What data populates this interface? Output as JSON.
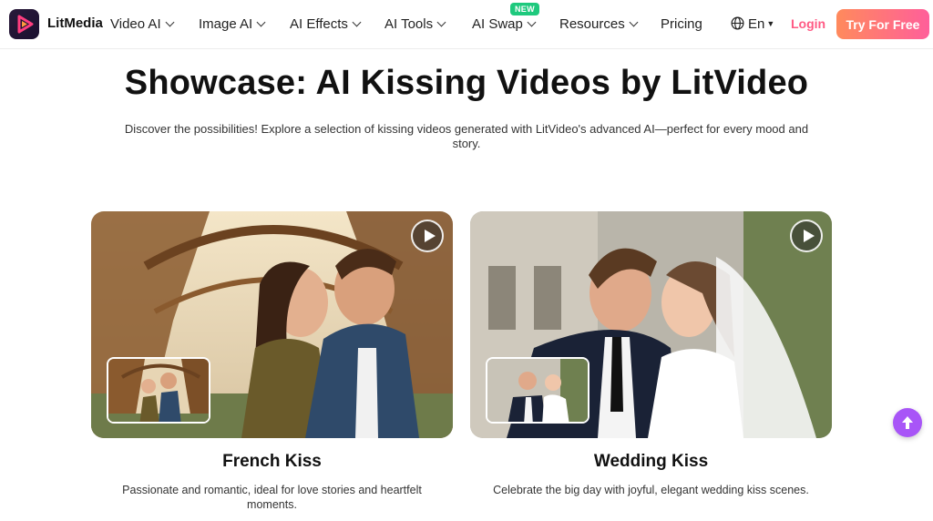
{
  "nav": {
    "brand": "LitMedia",
    "items": [
      {
        "label": "Video AI"
      },
      {
        "label": "Image AI"
      },
      {
        "label": "AI Effects"
      },
      {
        "label": "AI Tools"
      },
      {
        "label": "AI Swap",
        "badge": "NEW"
      },
      {
        "label": "Resources"
      },
      {
        "label": "Pricing"
      }
    ],
    "language": "En",
    "login": "Login",
    "cta": "Try For Free"
  },
  "hero": {
    "title": "Showcase: AI Kissing Videos by LitVideo",
    "subtitle": "Discover the possibilities! Explore a selection of kissing videos generated with LitVideo's advanced AI—perfect for every mood and story."
  },
  "cards": [
    {
      "title": "French Kiss",
      "description": "Passionate and romantic, ideal for love stories and heartfelt moments."
    },
    {
      "title": "Wedding Kiss",
      "description": "Celebrate the big day with joyful, elegant wedding kiss scenes."
    }
  ],
  "colors": {
    "accent_login": "#ff5a84",
    "cta_gradient_start": "#ff8a5c",
    "cta_gradient_end": "#ff5f9a",
    "new_badge": "#1ec97d",
    "scroll_top": "#a855f7"
  },
  "icons": {
    "logo": "litmedia-play-logo",
    "language": "globe-icon",
    "play": "play-icon",
    "scroll_top": "arrow-up-icon"
  }
}
